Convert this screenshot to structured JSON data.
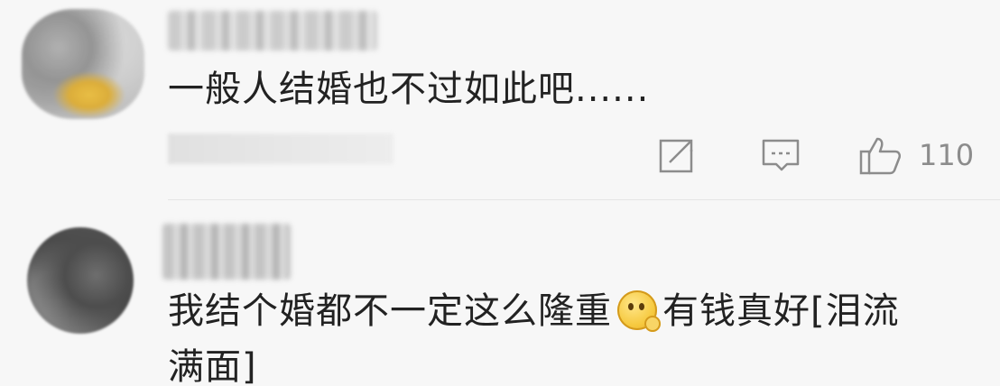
{
  "comments": [
    {
      "text": "一般人结婚也不过如此吧......",
      "actions": {
        "share_icon": "share-icon",
        "reply_icon": "reply-icon",
        "like_icon": "like-icon",
        "like_count": "110"
      }
    },
    {
      "text_before_emoji": "我结个婚都不一定这么隆重",
      "emoji": "thinking-emoji",
      "text_after_emoji": "有钱真好[泪流",
      "text_line2": "满面]"
    }
  ],
  "colors": {
    "background": "#f7f7f7",
    "text": "#222222",
    "icon": "#8c8c8c",
    "divider": "#e5e5e5"
  }
}
